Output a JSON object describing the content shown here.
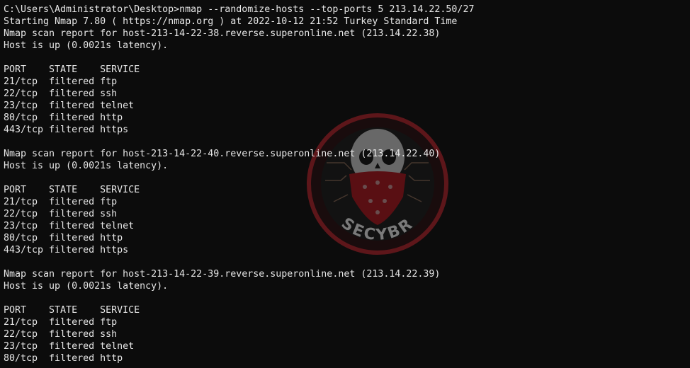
{
  "terminal": {
    "lines": [
      "C:\\Users\\Administrator\\Desktop>nmap --randomize-hosts --top-ports 5 213.14.22.50/27",
      "Starting Nmap 7.80 ( https://nmap.org ) at 2022-10-12 21:52 Turkey Standard Time",
      "Nmap scan report for host-213-14-22-38.reverse.superonline.net (213.14.22.38)",
      "Host is up (0.0021s latency).",
      "",
      "PORT    STATE    SERVICE",
      "21/tcp  filtered ftp",
      "22/tcp  filtered ssh",
      "23/tcp  filtered telnet",
      "80/tcp  filtered http",
      "443/tcp filtered https",
      "",
      "Nmap scan report for host-213-14-22-40.reverse.superonline.net (213.14.22.40)",
      "Host is up (0.0021s latency).",
      "",
      "PORT    STATE    SERVICE",
      "21/tcp  filtered ftp",
      "22/tcp  filtered ssh",
      "23/tcp  filtered telnet",
      "80/tcp  filtered http",
      "443/tcp filtered https",
      "",
      "Nmap scan report for host-213-14-22-39.reverse.superonline.net (213.14.22.39)",
      "Host is up (0.0021s latency).",
      "",
      "PORT    STATE    SERVICE",
      "21/tcp  filtered ftp",
      "22/tcp  filtered ssh",
      "23/tcp  filtered telnet",
      "80/tcp  filtered http"
    ]
  },
  "watermark": {
    "text": "SECYBR",
    "icon": "skull-bandana-logo",
    "ring_color": "#c0232b",
    "bandana_color": "#b8141c"
  },
  "colors": {
    "background": "#0c0c0c",
    "text": "#e6e6e6"
  }
}
